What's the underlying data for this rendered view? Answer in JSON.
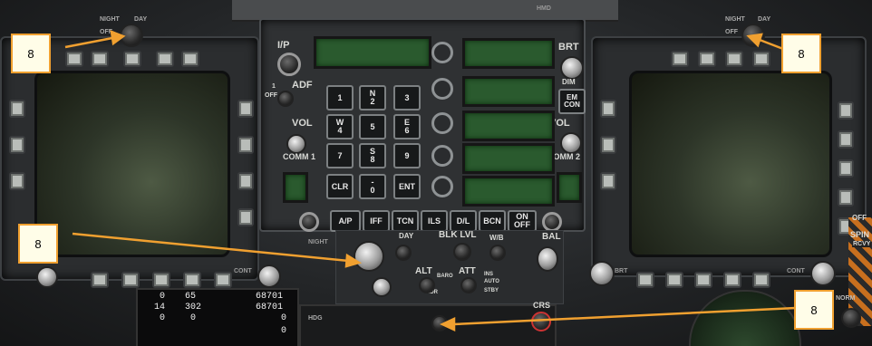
{
  "ufc": {
    "io_label": "I/P",
    "adf_label": "ADF",
    "adf_off": "OFF",
    "adf_1": "1",
    "vol_left": "VOL",
    "vol_right": "VOL",
    "comm1": "COMM 1",
    "comm2": "COMM 2",
    "brt": "BRT",
    "dim": "DIM",
    "emcon": "EM CON",
    "keypad": [
      {
        "top": "",
        "main": "1"
      },
      {
        "top": "N",
        "main": "2"
      },
      {
        "top": "",
        "main": "3"
      },
      {
        "top": "W",
        "main": "4"
      },
      {
        "top": "",
        "main": "5"
      },
      {
        "top": "E",
        "main": "6"
      },
      {
        "top": "",
        "main": "7"
      },
      {
        "top": "S",
        "main": "8"
      },
      {
        "top": "",
        "main": "9"
      },
      {
        "top": "",
        "main": "CLR"
      },
      {
        "top": "-",
        "main": "0"
      },
      {
        "top": "",
        "main": "ENT"
      }
    ],
    "function_keys": [
      "A/P",
      "IFF",
      "TCN",
      "ILS",
      "D/L",
      "BCN",
      "ON OFF"
    ]
  },
  "lower_panel": {
    "day": "DAY",
    "blk_lvl": "BLK LVL",
    "wb": "W/B",
    "bal": "BAL",
    "alt": "ALT",
    "baro": "BARO",
    "rdr": "RDR",
    "att": "ATT",
    "ins": "INS",
    "auto": "AUTO",
    "stby": "STBY",
    "crs": "CRS",
    "hdg": "HDG",
    "night": "NIGHT",
    "day_left": "DAY",
    "night_left": "NIGHT",
    "off_left": "OFF",
    "day_right": "DAY",
    "night_right": "NIGHT",
    "off_right": "OFF",
    "cont": "CONT",
    "cont_right": "CONT",
    "brt_right": "BRT",
    "norm": "NORM",
    "off_far_right": "OFF",
    "spin": "SPIN",
    "rcvy": "RCVY",
    "hmd": "HMD"
  },
  "engine_display": {
    "row1_left": "0",
    "row1_mid": "65",
    "row2_left": "14",
    "row2_mid": "302",
    "row3_left": "0",
    "row3_mid": "0",
    "right1": "68701",
    "right2": "68701",
    "right3": "0",
    "right4": "0"
  },
  "callouts": [
    "8",
    "8",
    "8",
    "8"
  ],
  "colors": {
    "callout_border": "#f0a030",
    "arrow": "#f0a030",
    "scratchpad": "#2a5a2e"
  }
}
